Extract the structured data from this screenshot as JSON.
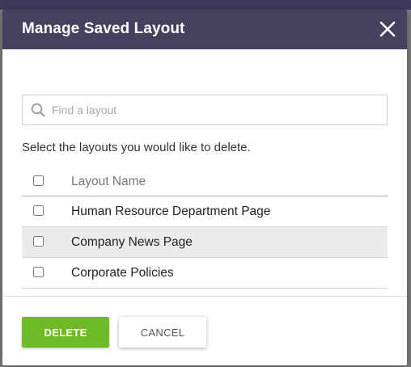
{
  "dialog": {
    "title": "Manage Saved Layout",
    "close_icon": "close-icon"
  },
  "search": {
    "icon": "search-icon",
    "placeholder": "Find a layout",
    "value": ""
  },
  "instruction": "Select the layouts you would like to delete.",
  "table": {
    "header": "Layout Name",
    "rows": [
      {
        "label": "Human Resource Department Page",
        "checked": false,
        "highlighted": false
      },
      {
        "label": "Company News Page",
        "checked": false,
        "highlighted": true
      },
      {
        "label": "Corporate Policies",
        "checked": false,
        "highlighted": false
      }
    ]
  },
  "footer": {
    "delete_label": "DELETE",
    "cancel_label": "CANCEL"
  },
  "colors": {
    "header_bg": "#48405f",
    "delete_bg": "#6fba27"
  }
}
